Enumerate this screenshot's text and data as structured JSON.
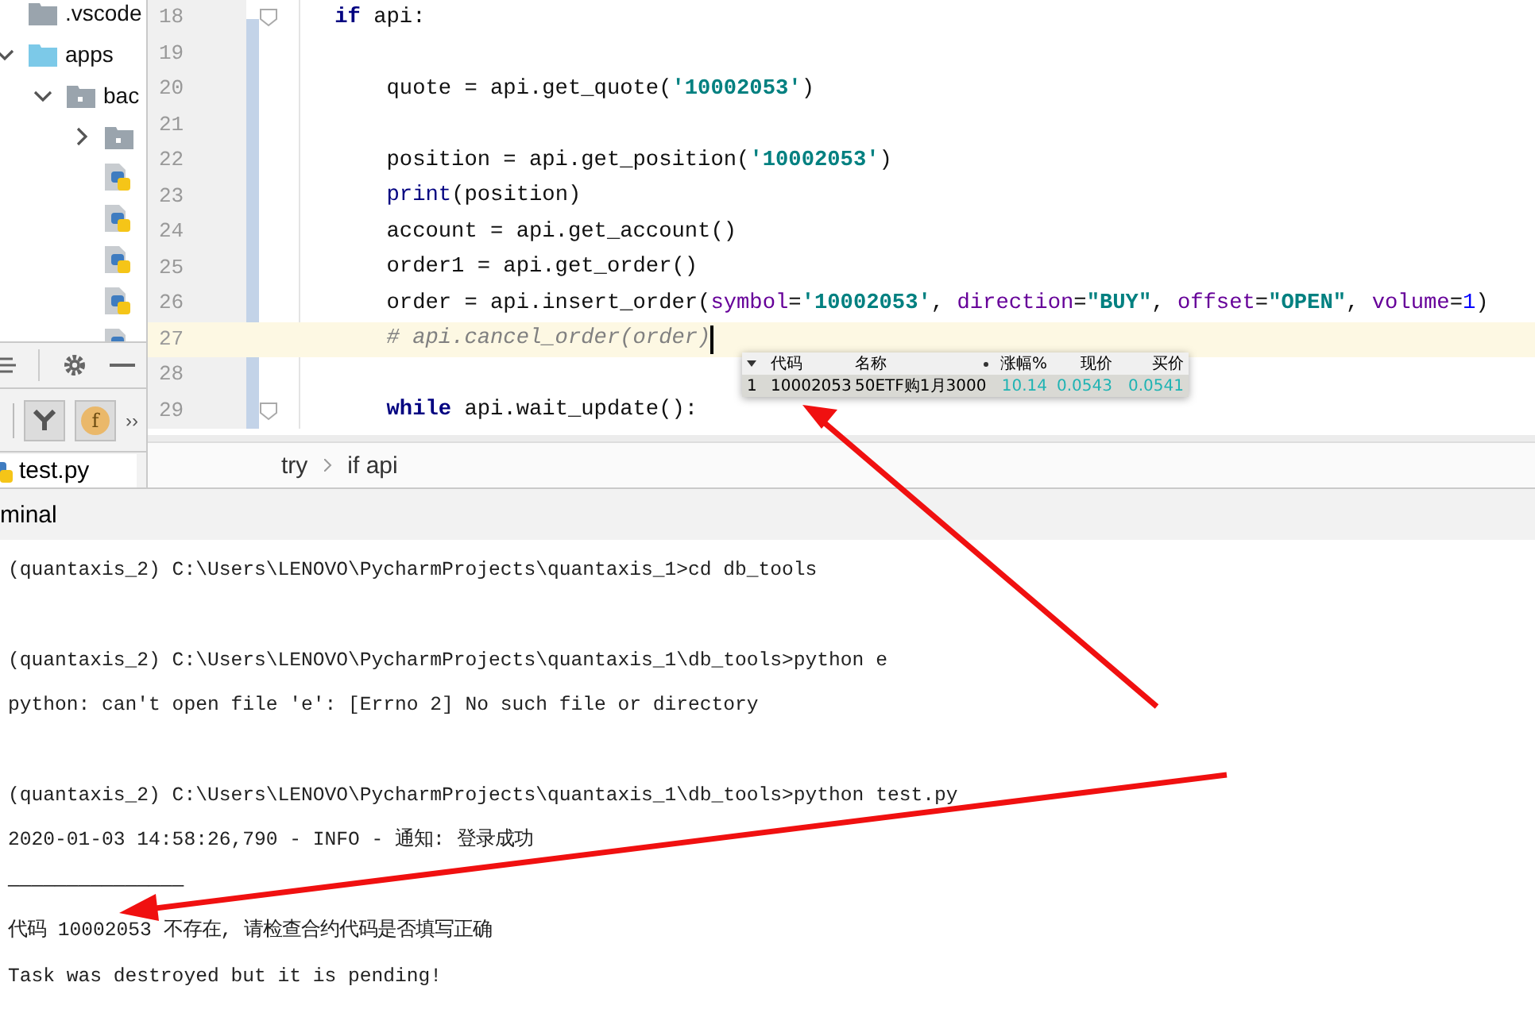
{
  "project_tree": [
    {
      "kind": "folder",
      "name": ".vscode"
    },
    {
      "kind": "sources",
      "name": "apps",
      "expanded": true,
      "children": [
        {
          "kind": "package",
          "name": "bac",
          "expanded": true,
          "children": [
            {
              "kind": "package",
              "expanded": false
            },
            {
              "kind": "file"
            },
            {
              "kind": "file"
            },
            {
              "kind": "file"
            },
            {
              "kind": "file"
            },
            {
              "kind": "file"
            }
          ]
        }
      ]
    }
  ],
  "tool_strip": {
    "function_button": "f",
    "more": "››"
  },
  "file_tab": {
    "label": "test.py",
    "selected": true
  },
  "editor": {
    "lines": [
      {
        "number": "18",
        "current": false,
        "tokens": [
          {
            "kind": "keyword",
            "text": "    if"
          },
          {
            "kind": "plain",
            "text": " api:"
          }
        ]
      },
      {
        "number": "19",
        "current": false
      },
      {
        "number": "20",
        "current": false,
        "tokens": [
          {
            "kind": "plain",
            "text": "        quote = api.get_quote("
          },
          {
            "kind": "string",
            "text": "'10002053'"
          },
          {
            "kind": "plain",
            "text": ")"
          }
        ]
      },
      {
        "number": "21",
        "current": false
      },
      {
        "number": "22",
        "current": false,
        "tokens": [
          {
            "kind": "plain",
            "text": "        position = api.get_position("
          },
          {
            "kind": "string",
            "text": "'10002053'"
          },
          {
            "kind": "plain",
            "text": ")"
          }
        ]
      },
      {
        "number": "23",
        "current": false,
        "tokens": [
          {
            "kind": "builtin",
            "text": "        print"
          },
          {
            "kind": "plain",
            "text": "(position)"
          }
        ]
      },
      {
        "number": "24",
        "current": false,
        "tokens": [
          {
            "kind": "plain",
            "text": "        account = api.get_account()"
          }
        ]
      },
      {
        "number": "25",
        "current": false,
        "tokens": [
          {
            "kind": "plain",
            "text": "        order1 = api.get_order()"
          }
        ]
      },
      {
        "number": "26",
        "current": false,
        "tokens": [
          {
            "kind": "plain",
            "text": "        order = api.insert_order("
          },
          {
            "kind": "param",
            "text": "symbol"
          },
          {
            "kind": "plain",
            "text": "="
          },
          {
            "kind": "string",
            "text": "'10002053'"
          },
          {
            "kind": "plain",
            "text": ", "
          },
          {
            "kind": "param",
            "text": "direction"
          },
          {
            "kind": "plain",
            "text": "="
          },
          {
            "kind": "string",
            "text": "\"BUY\""
          },
          {
            "kind": "plain",
            "text": ", "
          },
          {
            "kind": "param",
            "text": "offset"
          },
          {
            "kind": "plain",
            "text": "="
          },
          {
            "kind": "string",
            "text": "\"OPEN\""
          },
          {
            "kind": "plain",
            "text": ", "
          },
          {
            "kind": "param",
            "text": "volume"
          },
          {
            "kind": "plain",
            "text": "="
          },
          {
            "kind": "number",
            "text": "1"
          },
          {
            "kind": "plain",
            "text": ")"
          }
        ]
      },
      {
        "number": "27",
        "current": true,
        "tokens": [
          {
            "kind": "comment",
            "text": "        # api.cancel_order(order)"
          }
        ]
      },
      {
        "number": "28",
        "current": false
      },
      {
        "number": "29",
        "current": false,
        "tokens": [
          {
            "kind": "keyword",
            "text": "        while"
          },
          {
            "kind": "plain",
            "text": " api.wait_update():"
          }
        ]
      }
    ]
  },
  "quote_popup": {
    "columns": [
      {
        "label": "代码",
        "kind": "text",
        "sorted": false
      },
      {
        "label": "名称",
        "kind": "text",
        "sorted": true
      },
      {
        "label": "涨幅%",
        "kind": "number",
        "sorted": false
      },
      {
        "label": "现价",
        "kind": "number",
        "sorted": false
      },
      {
        "label": "买价",
        "kind": "number",
        "sorted": false
      }
    ],
    "rows": [
      {
        "index": "1",
        "cells": [
          "10002053",
          "50ETF购1月3000",
          "10.14",
          "0.0543",
          "0.0541"
        ]
      }
    ]
  },
  "breadcrumbs": [
    "try",
    "if api"
  ],
  "terminal": {
    "title": "minal",
    "lines": [
      {
        "kind": "command",
        "text": "(quantaxis_2) C:\\Users\\LENOVO\\PycharmProjects\\quantaxis_1>cd db_tools"
      },
      {
        "kind": "command",
        "text": "(quantaxis_2) C:\\Users\\LENOVO\\PycharmProjects\\quantaxis_1\\db_tools>python e"
      },
      {
        "kind": "output",
        "text": "python: can't open file 'e': [Errno 2] No such file or directory"
      },
      {
        "kind": "command",
        "text": "(quantaxis_2) C:\\Users\\LENOVO\\PycharmProjects\\quantaxis_1\\db_tools>python test.py"
      },
      {
        "kind": "output",
        "text": "2020-01-03 14:58:26,790 - INFO - 通知: 登录成功"
      },
      {
        "kind": "output",
        "text": "———————————————"
      },
      {
        "kind": "output",
        "text": "代码 10002053 不存在, 请检查合约代码是否填写正确"
      },
      {
        "kind": "output",
        "text": "Task was destroyed but it is pending!"
      }
    ]
  }
}
